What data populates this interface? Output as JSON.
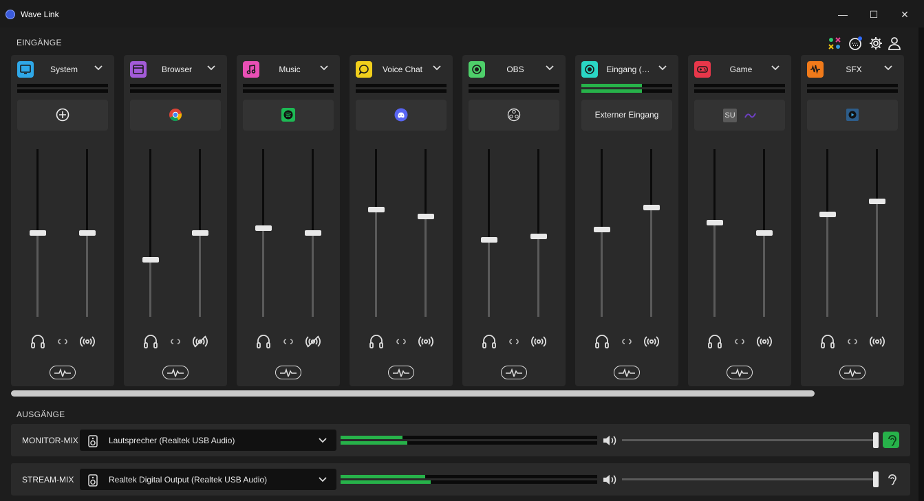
{
  "window": {
    "title": "Wave Link",
    "minimize": "—",
    "maximize": "☐",
    "close": "✕"
  },
  "sections": {
    "inputs": "EINGÄNGE",
    "outputs": "AUSGÄNGE"
  },
  "toolbar_icons": [
    "marketplace-icon",
    "notification-settings-icon",
    "gear-icon",
    "user-icon"
  ],
  "channels": [
    {
      "name": "System",
      "icon": "monitor-icon",
      "color": "#2fa8e8",
      "app": "add",
      "app_text": "",
      "meter": 0,
      "monitor_level": 0.5,
      "stream_level": 0.5,
      "stream_muted": false
    },
    {
      "name": "Browser",
      "icon": "browser-icon",
      "color": "#a35bd8",
      "app": "chrome",
      "app_text": "",
      "meter": 0,
      "monitor_level": 0.34,
      "stream_level": 0.5,
      "stream_muted": true
    },
    {
      "name": "Music",
      "icon": "music-note-icon",
      "color": "#e94fb5",
      "app": "spotify",
      "app_text": "",
      "meter": 0,
      "monitor_level": 0.53,
      "stream_level": 0.5,
      "stream_muted": true
    },
    {
      "name": "Voice Chat",
      "icon": "chat-bubble-icon",
      "color": "#f1cf1c",
      "app": "discord",
      "app_text": "",
      "meter": 0,
      "monitor_level": 0.64,
      "stream_level": 0.6,
      "stream_muted": false
    },
    {
      "name": "OBS",
      "icon": "record-icon",
      "color": "#4ecf6a",
      "app": "obs",
      "app_text": "",
      "meter": 0,
      "monitor_level": 0.46,
      "stream_level": 0.48,
      "stream_muted": false
    },
    {
      "name": "Eingang (…",
      "icon": "record-icon",
      "color": "#2ad6c4",
      "app": "text",
      "app_text": "Externer Eingang",
      "meter": 0.67,
      "monitor_level": 0.52,
      "stream_level": 0.65,
      "stream_muted": false
    },
    {
      "name": "Game",
      "icon": "gamepad-icon",
      "color": "#e8374a",
      "app": "game",
      "app_text": "SU",
      "meter": 0,
      "monitor_level": 0.56,
      "stream_level": 0.5,
      "stream_muted": false
    },
    {
      "name": "SFX",
      "icon": "waveform-icon",
      "color": "#f07a1a",
      "app": "media",
      "app_text": "",
      "meter": 0,
      "monitor_level": 0.61,
      "stream_level": 0.69,
      "stream_muted": false
    }
  ],
  "outputs": [
    {
      "label": "MONITOR-MIX",
      "device": "Lautsprecher (Realtek USB Audio)",
      "meter_top": 0.24,
      "meter_bottom": 0.26,
      "volume": 1.0,
      "listening": true
    },
    {
      "label": "STREAM-MIX",
      "device": "Realtek Digital Output (Realtek USB Audio)",
      "meter_top": 0.33,
      "meter_bottom": 0.35,
      "volume": 1.0,
      "listening": false
    }
  ],
  "colors": {
    "accent_green": "#27b24a",
    "panel": "#2a2a2a",
    "background": "#1d1d1d"
  }
}
